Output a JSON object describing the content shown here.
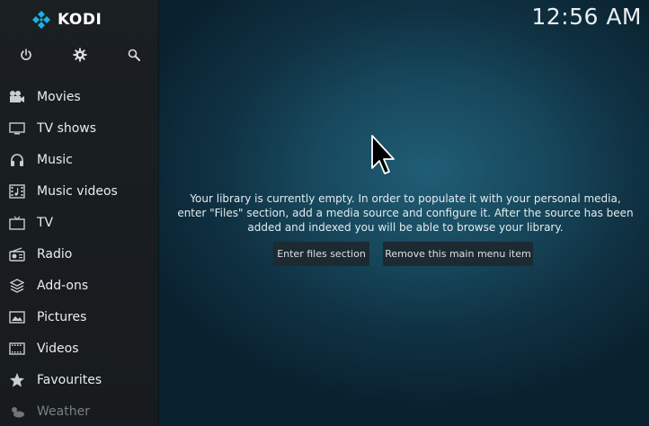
{
  "app": {
    "name": "KODI"
  },
  "clock": "12:56 AM",
  "top_icons": [
    {
      "name": "power-icon"
    },
    {
      "name": "gear-icon"
    },
    {
      "name": "search-icon"
    }
  ],
  "menu": {
    "items": [
      {
        "label": "Movies",
        "icon": "movie-camera-icon"
      },
      {
        "label": "TV shows",
        "icon": "monitor-icon"
      },
      {
        "label": "Music",
        "icon": "headphones-icon"
      },
      {
        "label": "Music videos",
        "icon": "film-music-icon"
      },
      {
        "label": "TV",
        "icon": "tv-icon"
      },
      {
        "label": "Radio",
        "icon": "radio-icon"
      },
      {
        "label": "Add-ons",
        "icon": "box-icon"
      },
      {
        "label": "Pictures",
        "icon": "picture-icon"
      },
      {
        "label": "Videos",
        "icon": "film-strip-icon"
      },
      {
        "label": "Favourites",
        "icon": "star-icon"
      },
      {
        "label": "Weather",
        "icon": "weather-icon"
      }
    ]
  },
  "main": {
    "message": "Your library is currently empty. In order to populate it with your personal media, enter \"Files\" section, add a media source and configure it. After the source has been added and indexed you will be able to browse your library.",
    "buttons": {
      "enter_files": "Enter files section",
      "remove_item": "Remove this main menu item"
    }
  },
  "colors": {
    "sidebar_bg": "#1a1f22",
    "main_bg": "#184a5f",
    "logo_blue": "#17b2e7",
    "button_bg": "#1d2a31"
  }
}
